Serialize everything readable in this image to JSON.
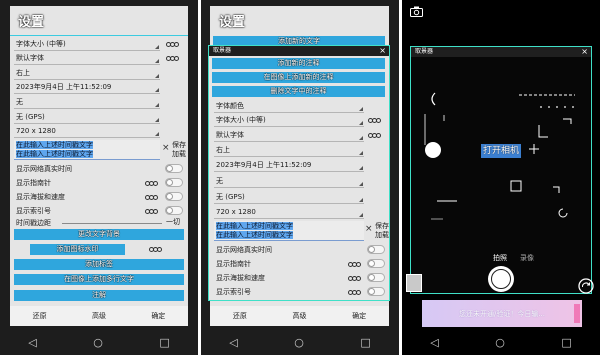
{
  "colors": {
    "button_blue": "#2fa6dd",
    "dialog_border": "#3fe0c8",
    "card_bg": "#e5e5e5",
    "screen_bg": "#1d1d1d",
    "selection_blue": "#5fa6ee"
  },
  "icons": {
    "close": "×",
    "back": "◁",
    "home": "○",
    "recents": "□",
    "more": "more-dots-icon",
    "dropdown": "dropdown-arrow-icon",
    "camera": "camera-icon",
    "rotate": "rotate-camera-icon"
  },
  "settings": {
    "title": "设置",
    "dropdowns": [
      "字体大小 (中等)",
      "默认字体",
      "右上",
      "2023年9月4日 上午11:52:09",
      "无",
      "无 (GPS)",
      "720 x 1280"
    ],
    "timestamp_text": {
      "line1": "在此输入上述时间戳文字",
      "line2": "在此输入上述时间戳文字",
      "save": "保存",
      "load": "加载"
    },
    "toggles": [
      "显示网络真实时间",
      "显示指南针",
      "显示海拔和速度",
      "显示索引号"
    ],
    "margin_slider": {
      "label": "时间戳边距",
      "value": "一切"
    },
    "buttons": [
      "更改文字背景",
      "添加图标水印",
      "添加标签",
      "在图像上添加多行文字",
      "注解"
    ],
    "footer": {
      "reset": "还原",
      "advanced": "高级",
      "confirm": "确定"
    }
  },
  "dialog_settings": {
    "title": "设置",
    "behind_button": "添加新的文字",
    "dialog_title": "取景器",
    "buttons": [
      "添加新的注释",
      "在图像上添加新的注释",
      "删除文字中的注释"
    ],
    "dropdowns": [
      "字体颜色",
      "字体大小 (中等)",
      "默认字体",
      "右上",
      "2023年9月4日 上午11:52:09",
      "无",
      "无 (GPS)",
      "720 x 1280"
    ],
    "timestamp_text": {
      "line1": "在此输入上述时间戳文字",
      "line2": "在此输入上述时间戳文字",
      "save": "保存",
      "load": "加载"
    },
    "toggles": [
      "显示网络真实时间",
      "显示指南针",
      "显示海拔和速度",
      "显示索引号"
    ],
    "footer": {
      "reset": "还原",
      "advanced": "高级",
      "confirm": "确定"
    }
  },
  "camera": {
    "dialog_title": "取景器",
    "preview_label": "打开相机",
    "modes": [
      "拍照",
      "录像"
    ],
    "active_mode": "拍照",
    "banner": "您还未开通/验证！今日输..."
  }
}
